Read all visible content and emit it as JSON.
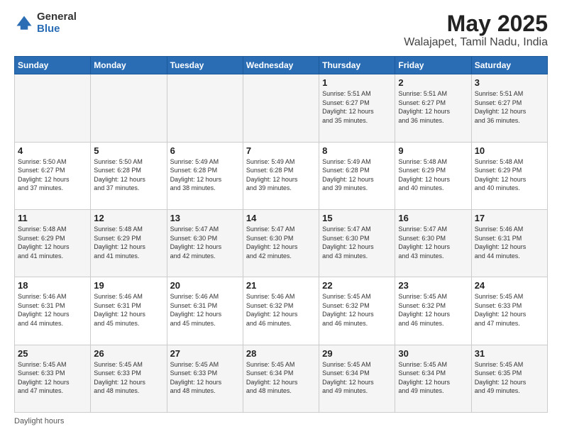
{
  "logo": {
    "general": "General",
    "blue": "Blue"
  },
  "title": "May 2025",
  "subtitle": "Walajapet, Tamil Nadu, India",
  "days_header": [
    "Sunday",
    "Monday",
    "Tuesday",
    "Wednesday",
    "Thursday",
    "Friday",
    "Saturday"
  ],
  "footer": "Daylight hours",
  "weeks": [
    [
      {
        "num": "",
        "info": ""
      },
      {
        "num": "",
        "info": ""
      },
      {
        "num": "",
        "info": ""
      },
      {
        "num": "",
        "info": ""
      },
      {
        "num": "1",
        "info": "Sunrise: 5:51 AM\nSunset: 6:27 PM\nDaylight: 12 hours\nand 35 minutes."
      },
      {
        "num": "2",
        "info": "Sunrise: 5:51 AM\nSunset: 6:27 PM\nDaylight: 12 hours\nand 36 minutes."
      },
      {
        "num": "3",
        "info": "Sunrise: 5:51 AM\nSunset: 6:27 PM\nDaylight: 12 hours\nand 36 minutes."
      }
    ],
    [
      {
        "num": "4",
        "info": "Sunrise: 5:50 AM\nSunset: 6:27 PM\nDaylight: 12 hours\nand 37 minutes."
      },
      {
        "num": "5",
        "info": "Sunrise: 5:50 AM\nSunset: 6:28 PM\nDaylight: 12 hours\nand 37 minutes."
      },
      {
        "num": "6",
        "info": "Sunrise: 5:49 AM\nSunset: 6:28 PM\nDaylight: 12 hours\nand 38 minutes."
      },
      {
        "num": "7",
        "info": "Sunrise: 5:49 AM\nSunset: 6:28 PM\nDaylight: 12 hours\nand 39 minutes."
      },
      {
        "num": "8",
        "info": "Sunrise: 5:49 AM\nSunset: 6:28 PM\nDaylight: 12 hours\nand 39 minutes."
      },
      {
        "num": "9",
        "info": "Sunrise: 5:48 AM\nSunset: 6:29 PM\nDaylight: 12 hours\nand 40 minutes."
      },
      {
        "num": "10",
        "info": "Sunrise: 5:48 AM\nSunset: 6:29 PM\nDaylight: 12 hours\nand 40 minutes."
      }
    ],
    [
      {
        "num": "11",
        "info": "Sunrise: 5:48 AM\nSunset: 6:29 PM\nDaylight: 12 hours\nand 41 minutes."
      },
      {
        "num": "12",
        "info": "Sunrise: 5:48 AM\nSunset: 6:29 PM\nDaylight: 12 hours\nand 41 minutes."
      },
      {
        "num": "13",
        "info": "Sunrise: 5:47 AM\nSunset: 6:30 PM\nDaylight: 12 hours\nand 42 minutes."
      },
      {
        "num": "14",
        "info": "Sunrise: 5:47 AM\nSunset: 6:30 PM\nDaylight: 12 hours\nand 42 minutes."
      },
      {
        "num": "15",
        "info": "Sunrise: 5:47 AM\nSunset: 6:30 PM\nDaylight: 12 hours\nand 43 minutes."
      },
      {
        "num": "16",
        "info": "Sunrise: 5:47 AM\nSunset: 6:30 PM\nDaylight: 12 hours\nand 43 minutes."
      },
      {
        "num": "17",
        "info": "Sunrise: 5:46 AM\nSunset: 6:31 PM\nDaylight: 12 hours\nand 44 minutes."
      }
    ],
    [
      {
        "num": "18",
        "info": "Sunrise: 5:46 AM\nSunset: 6:31 PM\nDaylight: 12 hours\nand 44 minutes."
      },
      {
        "num": "19",
        "info": "Sunrise: 5:46 AM\nSunset: 6:31 PM\nDaylight: 12 hours\nand 45 minutes."
      },
      {
        "num": "20",
        "info": "Sunrise: 5:46 AM\nSunset: 6:31 PM\nDaylight: 12 hours\nand 45 minutes."
      },
      {
        "num": "21",
        "info": "Sunrise: 5:46 AM\nSunset: 6:32 PM\nDaylight: 12 hours\nand 46 minutes."
      },
      {
        "num": "22",
        "info": "Sunrise: 5:45 AM\nSunset: 6:32 PM\nDaylight: 12 hours\nand 46 minutes."
      },
      {
        "num": "23",
        "info": "Sunrise: 5:45 AM\nSunset: 6:32 PM\nDaylight: 12 hours\nand 46 minutes."
      },
      {
        "num": "24",
        "info": "Sunrise: 5:45 AM\nSunset: 6:33 PM\nDaylight: 12 hours\nand 47 minutes."
      }
    ],
    [
      {
        "num": "25",
        "info": "Sunrise: 5:45 AM\nSunset: 6:33 PM\nDaylight: 12 hours\nand 47 minutes."
      },
      {
        "num": "26",
        "info": "Sunrise: 5:45 AM\nSunset: 6:33 PM\nDaylight: 12 hours\nand 48 minutes."
      },
      {
        "num": "27",
        "info": "Sunrise: 5:45 AM\nSunset: 6:33 PM\nDaylight: 12 hours\nand 48 minutes."
      },
      {
        "num": "28",
        "info": "Sunrise: 5:45 AM\nSunset: 6:34 PM\nDaylight: 12 hours\nand 48 minutes."
      },
      {
        "num": "29",
        "info": "Sunrise: 5:45 AM\nSunset: 6:34 PM\nDaylight: 12 hours\nand 49 minutes."
      },
      {
        "num": "30",
        "info": "Sunrise: 5:45 AM\nSunset: 6:34 PM\nDaylight: 12 hours\nand 49 minutes."
      },
      {
        "num": "31",
        "info": "Sunrise: 5:45 AM\nSunset: 6:35 PM\nDaylight: 12 hours\nand 49 minutes."
      }
    ]
  ]
}
